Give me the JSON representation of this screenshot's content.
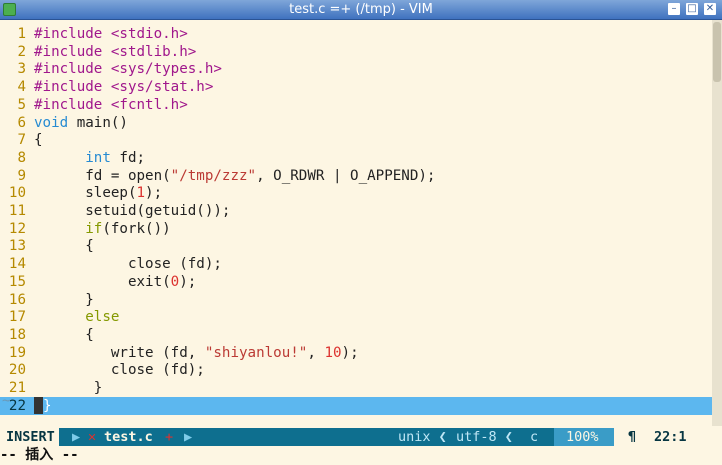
{
  "window": {
    "title": "test.c =+ (/tmp) - VIM",
    "buttons": [
      "–",
      "□",
      "✕"
    ]
  },
  "lines": [
    {
      "num": "1",
      "segments": [
        {
          "t": "#include ",
          "c": "pp"
        },
        {
          "t": "<stdio.h>",
          "c": "pp"
        }
      ]
    },
    {
      "num": "2",
      "segments": [
        {
          "t": "#include ",
          "c": "pp"
        },
        {
          "t": "<stdlib.h>",
          "c": "pp"
        }
      ]
    },
    {
      "num": "3",
      "segments": [
        {
          "t": "#include ",
          "c": "pp"
        },
        {
          "t": "<sys/types.h>",
          "c": "pp"
        }
      ]
    },
    {
      "num": "4",
      "segments": [
        {
          "t": "#include ",
          "c": "pp"
        },
        {
          "t": "<sys/stat.h>",
          "c": "pp"
        }
      ]
    },
    {
      "num": "5",
      "segments": [
        {
          "t": "#include ",
          "c": "pp"
        },
        {
          "t": "<fcntl.h>",
          "c": "pp"
        }
      ]
    },
    {
      "num": "6",
      "segments": [
        {
          "t": "void",
          "c": "ty"
        },
        {
          "t": " main()",
          "c": ""
        }
      ]
    },
    {
      "num": "7",
      "segments": [
        {
          "t": "{",
          "c": ""
        }
      ]
    },
    {
      "num": "8",
      "segments": [
        {
          "t": "      ",
          "c": ""
        },
        {
          "t": "int",
          "c": "ty"
        },
        {
          "t": " fd;",
          "c": ""
        }
      ]
    },
    {
      "num": "9",
      "segments": [
        {
          "t": "      fd = open(",
          "c": ""
        },
        {
          "t": "\"/tmp/zzz\"",
          "c": "str"
        },
        {
          "t": ", O_RDWR | O_APPEND);",
          "c": ""
        }
      ]
    },
    {
      "num": "10",
      "segments": [
        {
          "t": "      sleep(",
          "c": ""
        },
        {
          "t": "1",
          "c": "num"
        },
        {
          "t": ");",
          "c": ""
        }
      ]
    },
    {
      "num": "11",
      "segments": [
        {
          "t": "      setuid(getuid());",
          "c": ""
        }
      ]
    },
    {
      "num": "12",
      "segments": [
        {
          "t": "      ",
          "c": ""
        },
        {
          "t": "if",
          "c": "kw"
        },
        {
          "t": "(fork())",
          "c": ""
        }
      ]
    },
    {
      "num": "13",
      "segments": [
        {
          "t": "      {",
          "c": ""
        }
      ]
    },
    {
      "num": "14",
      "segments": [
        {
          "t": "           close (fd);",
          "c": ""
        }
      ]
    },
    {
      "num": "15",
      "segments": [
        {
          "t": "           exit(",
          "c": ""
        },
        {
          "t": "0",
          "c": "num"
        },
        {
          "t": ");",
          "c": ""
        }
      ]
    },
    {
      "num": "16",
      "segments": [
        {
          "t": "      }",
          "c": ""
        }
      ]
    },
    {
      "num": "17",
      "segments": [
        {
          "t": "      ",
          "c": ""
        },
        {
          "t": "else",
          "c": "kw"
        }
      ]
    },
    {
      "num": "18",
      "segments": [
        {
          "t": "      {",
          "c": ""
        }
      ]
    },
    {
      "num": "19",
      "segments": [
        {
          "t": "         write (fd, ",
          "c": ""
        },
        {
          "t": "\"shiyanlou!\"",
          "c": "str"
        },
        {
          "t": ", ",
          "c": ""
        },
        {
          "t": "10",
          "c": "num"
        },
        {
          "t": ");",
          "c": ""
        }
      ]
    },
    {
      "num": "20",
      "segments": [
        {
          "t": "         close (fd);",
          "c": ""
        }
      ]
    },
    {
      "num": "21",
      "segments": [
        {
          "t": "       }",
          "c": ""
        }
      ]
    },
    {
      "num": "22",
      "segments": [
        {
          "t": "}",
          "c": "brace-hl"
        }
      ],
      "current": true
    }
  ],
  "tilde": "~",
  "status": {
    "mode": "INSERT",
    "modified_marker": "✕",
    "filename": "test.c",
    "modified_flag": "+",
    "fileformat": "unix ❮",
    "encoding": "utf-8 ❮",
    "filetype": "c",
    "percent": "100%",
    "pilcrow": "¶",
    "position": "22:1"
  },
  "cmdline": "-- 插入 --"
}
